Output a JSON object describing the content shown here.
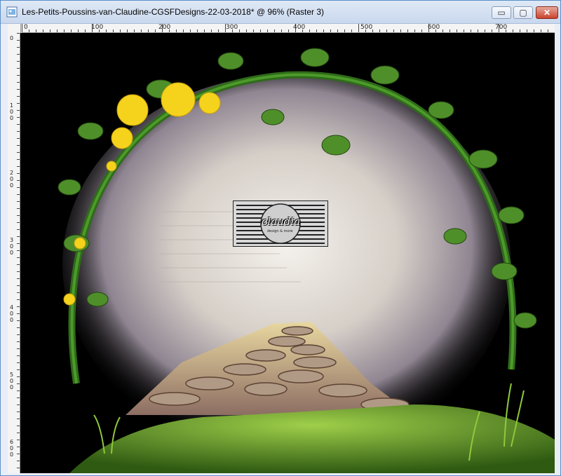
{
  "window": {
    "title": "Les-Petits-Poussins-van-Claudine-CGSFDesigns-22-03-2018* @  96% (Raster 3)",
    "icons": {
      "app": "psp-image-icon",
      "minimize": "minimize-icon",
      "maximize": "maximize-icon",
      "close": "close-icon"
    },
    "buttons": {
      "minimize": "▭",
      "maximize": "▢",
      "close": "✕"
    }
  },
  "ruler": {
    "top_labels": [
      "0",
      "100",
      "200",
      "300",
      "400",
      "500",
      "600",
      "700"
    ],
    "left_labels": [
      "0",
      "1 0 0",
      "2 0 0",
      "3 0 0",
      "4 0 0",
      "5 0 0",
      "6 0 0"
    ]
  },
  "watermark": {
    "text": "claudia",
    "subtext": "design & more"
  },
  "colors": {
    "title_bar": "#c9d8ee",
    "close_button": "#c9432d",
    "canvas_bg": "#000000"
  }
}
